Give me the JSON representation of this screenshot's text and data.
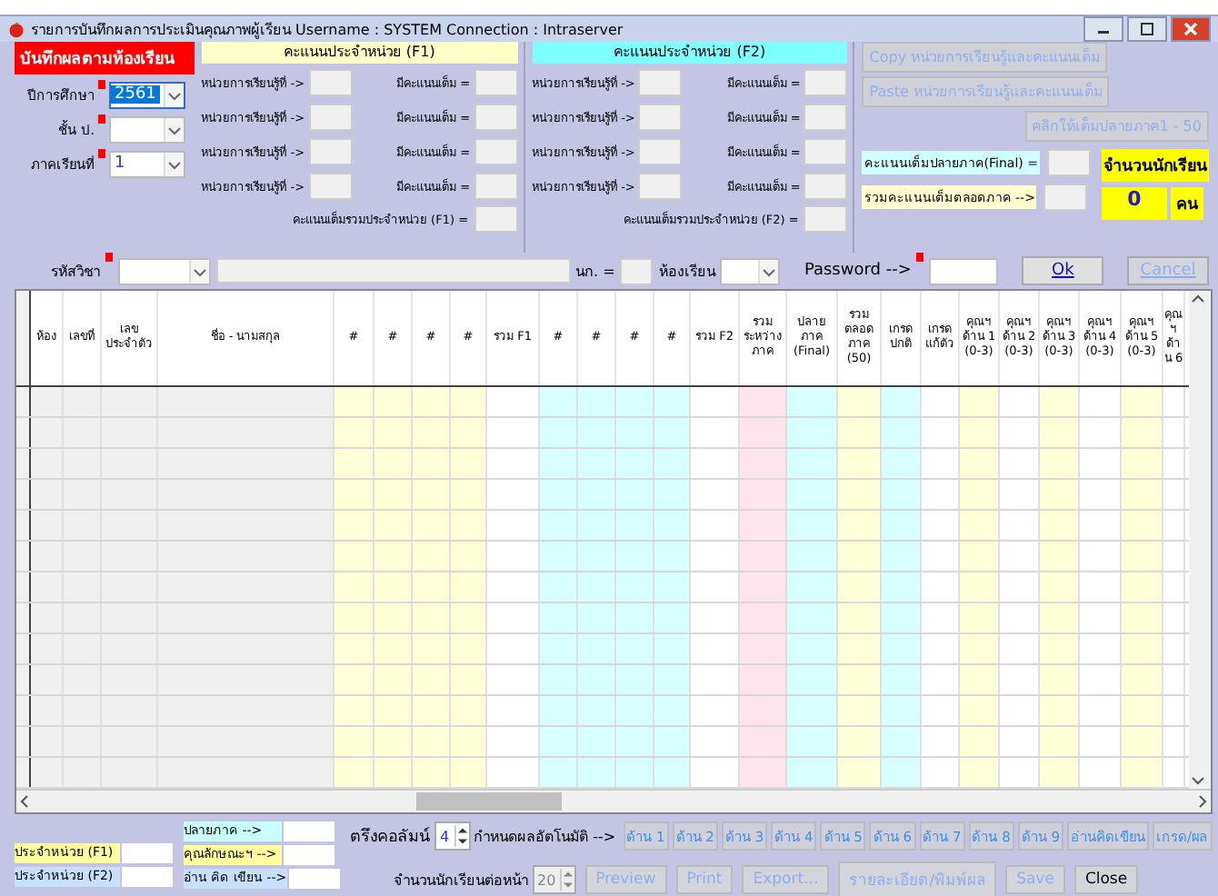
{
  "window": {
    "title": "รายการบันทึกผลการประเมินคุณภาพผู้เรียน  Username : SYSTEM  Connection : Intraserver"
  },
  "heading": "บันทึกผลตามห้องเรียน",
  "filters": [
    {
      "label": "ปีการศึกษา",
      "value": "2561",
      "required": true,
      "highlighted": true
    },
    {
      "label": "ชั้น ป.",
      "required": true,
      "highlighted": false
    },
    {
      "label": "ภาคเรียนที่",
      "value": "1",
      "required": true,
      "highlighted": false
    }
  ],
  "units": [
    {
      "title": "คะแนนประจำหน่วย (F1)",
      "color": "#ffffc8",
      "rows": [
        {
          "unit_label": "หน่วยการเรียนรู้ที่ ->",
          "max_label": "มีคะแนนเต็ม ="
        },
        {
          "unit_label": "หน่วยการเรียนรู้ที่ ->",
          "max_label": "มีคะแนนเต็ม ="
        },
        {
          "unit_label": "หน่วยการเรียนรู้ที่ ->",
          "max_label": "มีคะแนนเต็ม ="
        },
        {
          "unit_label": "หน่วยการเรียนรู้ที่ ->",
          "max_label": "มีคะแนนเต็ม ="
        }
      ],
      "total_label": "คะแนนเต็มรวมประจำหน่วย (F1) ="
    },
    {
      "title": "คะแนนประจำหน่วย (F2)",
      "color": "#80ffff",
      "rows": [
        {
          "unit_label": "หน่วยการเรียนรู้ที่ ->",
          "max_label": "มีคะแนนเต็ม ="
        },
        {
          "unit_label": "หน่วยการเรียนรู้ที่ ->",
          "max_label": "มีคะแนนเต็ม ="
        },
        {
          "unit_label": "หน่วยการเรียนรู้ที่ ->",
          "max_label": "มีคะแนนเต็ม ="
        },
        {
          "unit_label": "หน่วยการเรียนรู้ที่ ->",
          "max_label": "มีคะแนนเต็ม ="
        }
      ],
      "total_label": "คะแนนเต็มรวมประจำหน่วย (F2) ="
    }
  ],
  "tool_buttons": [
    {
      "label": "Copy หน่วยการเรียนรู้และคะแนนเต็ม",
      "disabled": true
    },
    {
      "label": "Paste หน่วยการเรียนรู้และคะแนนเต็ม",
      "disabled": true
    },
    {
      "label": "คลิกให้เต็มปลายภาค1 - 50",
      "disabled": true
    }
  ],
  "full_scores": [
    {
      "label": "คะแนนเต็มปลายภาค(Final) =",
      "color": "#d0ffff"
    },
    {
      "label": "รวมคะแนนเต็มตลอดภาค -->",
      "color": "#ffffd0"
    }
  ],
  "students": {
    "label": "จำนวนนักเรียน",
    "count": "0",
    "unit": "คน"
  },
  "subject_row": {
    "code_label": "รหัสวิชา",
    "credit_label": "นก. =",
    "room_label": "ห้องเรียน",
    "password_label": "Password -->"
  },
  "dialog_buttons": [
    {
      "label": "Ok",
      "disabled": false
    },
    {
      "label": "Cancel",
      "disabled": true
    }
  ],
  "grid": {
    "columns": [
      {
        "label": "ห้อง",
        "color": "#f0f0f0"
      },
      {
        "label": "เลขที่",
        "color": "#f0f0f0"
      },
      {
        "label": "เลข ประจำตัว",
        "color": "#f0f0f0"
      },
      {
        "label": "ชื่อ - นามสกุล",
        "color": "#f0f0f0"
      },
      {
        "label": "#",
        "color": "#ffffd8"
      },
      {
        "label": "#",
        "color": "#ffffd8"
      },
      {
        "label": "#",
        "color": "#ffffd8"
      },
      {
        "label": "#",
        "color": "#ffffd8"
      },
      {
        "label": "รวม F1",
        "color": "#ffffff"
      },
      {
        "label": "#",
        "color": "#d8ffff"
      },
      {
        "label": "#",
        "color": "#d8ffff"
      },
      {
        "label": "#",
        "color": "#d8ffff"
      },
      {
        "label": "#",
        "color": "#d8ffff"
      },
      {
        "label": "รวม F2",
        "color": "#ffffff"
      },
      {
        "label": "รวม ระหว่าง ภาค",
        "color": "#ffe4ee"
      },
      {
        "label": "ปลาย ภาค (Final)",
        "color": "#d8ffff"
      },
      {
        "label": "รวม ตลอด ภาค (50)",
        "color": "#ffffd8"
      },
      {
        "label": "เกรด ปกติ",
        "color": "#d8ffff"
      },
      {
        "label": "เกรด แก้ตัว",
        "color": "#ffffff"
      },
      {
        "label": "คุณฯ ด้าน 1 (0-3)",
        "color": "#ffffd8"
      },
      {
        "label": "คุณฯ ด้าน 2 (0-3)",
        "color": "#ffffff"
      },
      {
        "label": "คุณฯ ด้าน 3 (0-3)",
        "color": "#ffffd8"
      },
      {
        "label": "คุณฯ ด้าน 4 (0-3)",
        "color": "#ffffff"
      },
      {
        "label": "คุณฯ ด้าน 5 (0-3)",
        "color": "#ffffd8"
      },
      {
        "label": "คุณฯ ด้าน 6",
        "color": "#ffffff"
      }
    ]
  },
  "legend": [
    {
      "label": "ประจำหน่วย (F1)",
      "color": "#ffffa0"
    },
    {
      "label": "ประจำหน่วย (F2)",
      "color": "#c8e0ff"
    }
  ],
  "groups": [
    {
      "label": "ปลายภาค -->",
      "color": "#c8ffff"
    },
    {
      "label": "คุณลักษณะฯ -->",
      "color": "#ffffa0"
    },
    {
      "label": "อ่าน คิด เขียน -->",
      "color": "#c8e0ff"
    }
  ],
  "freeze": {
    "label": "ตรึงคอลัมน์",
    "value": "4"
  },
  "auto_label": "กำหนดผลอัตโนมัติ -->",
  "auto_buttons": [
    {
      "label": "ด้าน 1",
      "disabled": true
    },
    {
      "label": "ด้าน 2",
      "disabled": true
    },
    {
      "label": "ด้าน 3",
      "disabled": true
    },
    {
      "label": "ด้าน 4",
      "disabled": true
    },
    {
      "label": "ด้าน 5",
      "disabled": true
    },
    {
      "label": "ด้าน 6",
      "disabled": true
    },
    {
      "label": "ด้าน 7",
      "disabled": true
    },
    {
      "label": "ด้าน 8",
      "disabled": true
    },
    {
      "label": "ด้าน 9",
      "disabled": true
    },
    {
      "label": "อ่านคิดเขียน",
      "disabled": true
    },
    {
      "label": "เกรด/ผล",
      "disabled": true
    }
  ],
  "per_page": {
    "label": "จำนวนนักเรียนต่อหน้า",
    "value": "20"
  },
  "actions": [
    {
      "label": "Preview",
      "disabled": true
    },
    {
      "label": "Print",
      "disabled": true
    },
    {
      "label": "Export...",
      "disabled": true
    },
    {
      "label": "รายละเอียด/พิมพ์ผล",
      "disabled": true
    },
    {
      "label": "Save",
      "disabled": true
    },
    {
      "label": "Close",
      "disabled": false
    }
  ]
}
